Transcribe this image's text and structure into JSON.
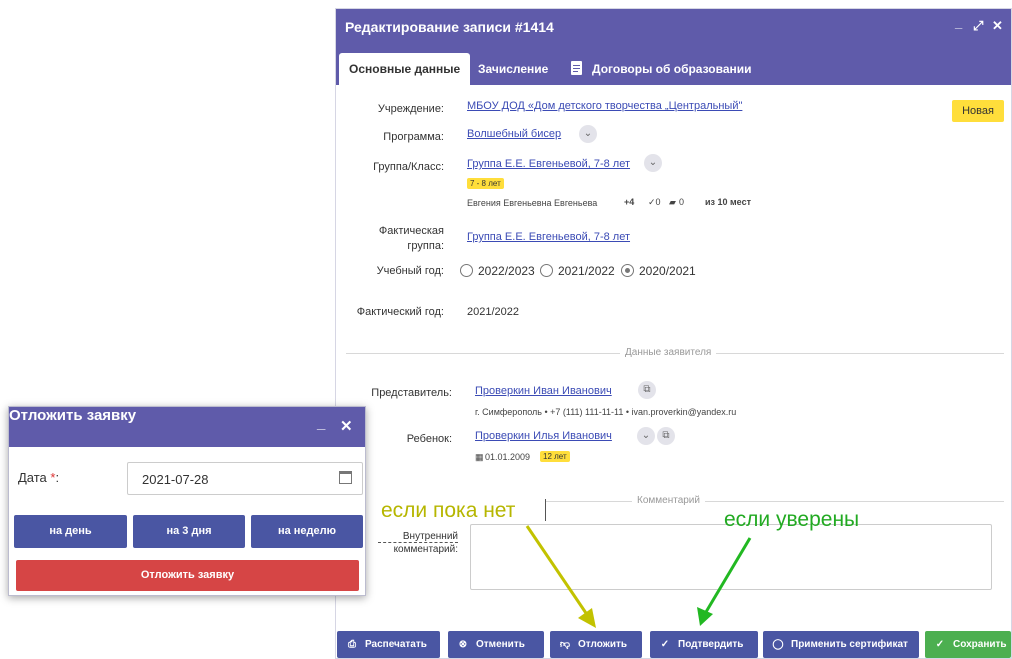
{
  "main": {
    "title": "Редактирование записи #1414",
    "controls": {
      "minimize": "_",
      "maximize": "⤢",
      "close": "✕"
    },
    "tabs": [
      {
        "label": "Основные данные"
      },
      {
        "label": "Зачисление"
      },
      {
        "label": "Договоры об образовании"
      }
    ],
    "status_badge": "Новая",
    "status_color": "#ffde3b",
    "fields": {
      "institution_label": "Учреждение:",
      "institution_value": "МБОУ ДОД «Дом детского творчества „Центральный\"",
      "program_label": "Программа:",
      "program_value": "Волшебный бисер",
      "group_label": "Группа/Класс:",
      "group_value": "Группа Е.Е. Евгеньевой, 7-8 лет",
      "group_age_badge": "7 - 8 лет",
      "group_teacher": "Евгения Евгеньевна Евгеньева",
      "group_plus": "+4",
      "group_check": "✓0",
      "group_cap": "0",
      "group_places": "из 10 мест",
      "actual_group_label_1": "Фактическая",
      "actual_group_label_2": "группа:",
      "actual_group_value": "Группа Е.Е. Евгеньевой, 7-8 лет",
      "school_year_label": "Учебный год:",
      "school_year_options": [
        "2022/2023",
        "2021/2022",
        "2020/2021"
      ],
      "school_year_selected": "2020/2021",
      "actual_year_label": "Фактический год:",
      "actual_year_value": "2021/2022"
    },
    "applicant_section": "Данные заявителя",
    "representative_label": "Представитель:",
    "representative_value": "Проверкин Иван Иванович",
    "representative_contacts": "г. Симферополь • +7 (111) 111-11-11 • ivan.proverkin@yandex.ru",
    "child_label": "Ребенок:",
    "child_value": "Проверкин Илья Иванович",
    "child_birth": "01.01.2009",
    "child_age_badge": "12 лет",
    "comment_section": "Комментарий",
    "internal_comment_label_1": "Внутренний",
    "internal_comment_label_2": "комментарий:",
    "buttons": {
      "print": "Распечатать",
      "cancel": "Отменить",
      "postpone": "Отложить",
      "confirm": "Подтвердить",
      "certificate": "Применить сертификат",
      "save": "Сохранить"
    },
    "colors": {
      "header": "#5f5baa",
      "button_primary": "#4a56a3",
      "button_save": "#4caf50"
    }
  },
  "popup": {
    "title": "Отложить заявку",
    "controls": {
      "minimize": "_",
      "close": "✕"
    },
    "date_label": "Дата",
    "required_mark": "*",
    "date_value": "2021-07-28",
    "btn_day": "на день",
    "btn_3days": "на 3 дня",
    "btn_week": "на неделю",
    "btn_submit": "Отложить заявку",
    "colors": {
      "submit": "#d64545"
    }
  },
  "annotations": {
    "left": "если пока нет",
    "right": "если уверены",
    "left_color": "#b6b600",
    "right_color": "#22aa22"
  }
}
